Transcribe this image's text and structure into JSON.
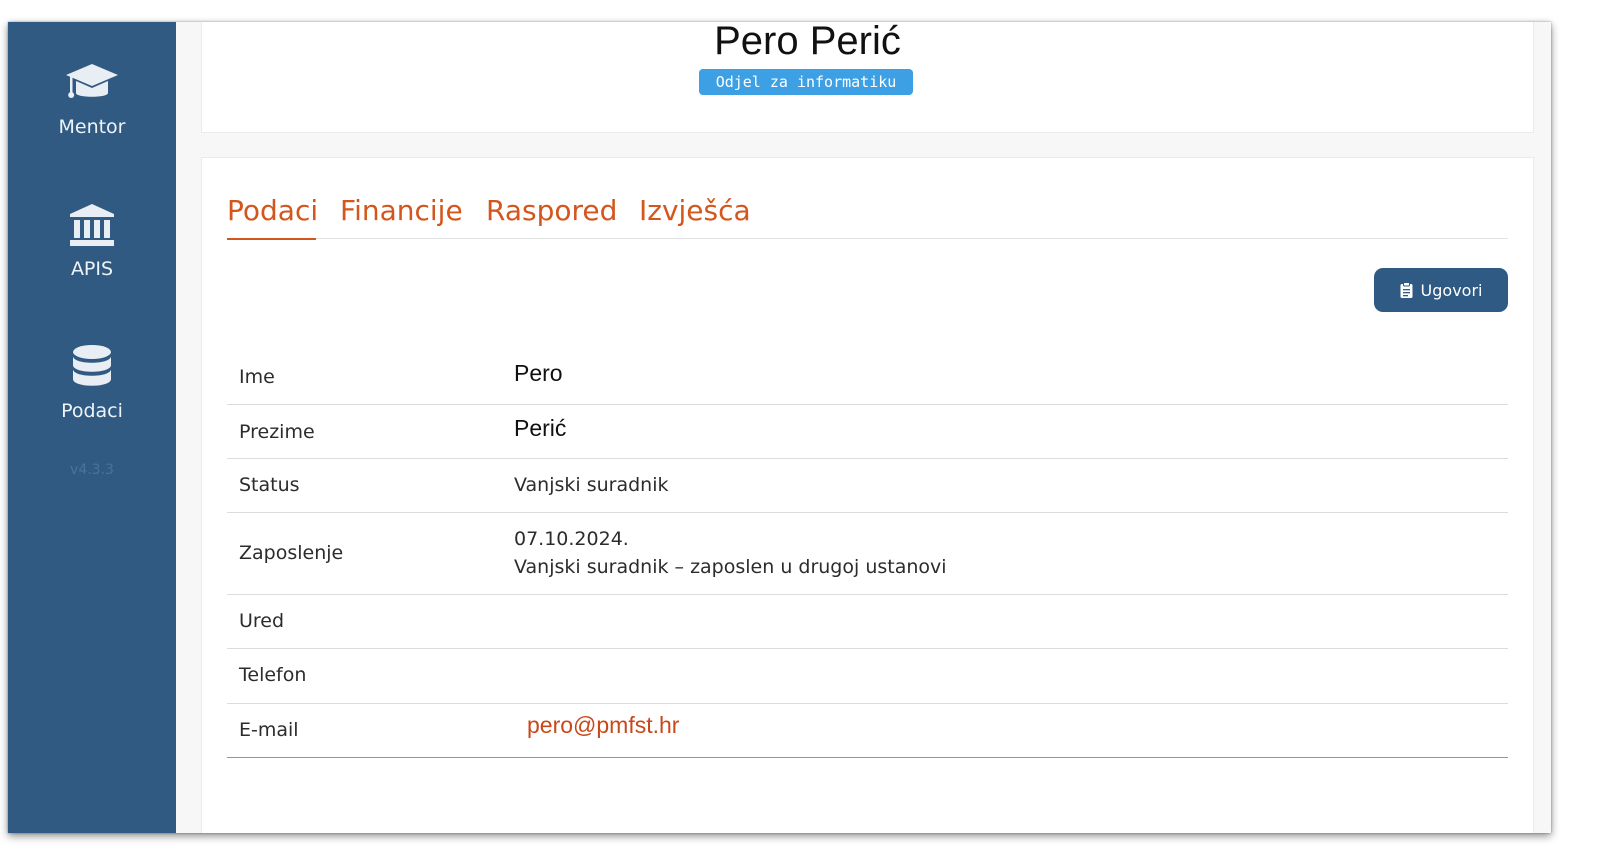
{
  "sidebar": {
    "items": [
      {
        "label": "Mentor",
        "icon": "graduation-cap-icon"
      },
      {
        "label": "APIS",
        "icon": "bank-icon"
      },
      {
        "label": "Podaci",
        "icon": "database-icon"
      }
    ],
    "version": "v4.3.3"
  },
  "header": {
    "name": "Pero Perić",
    "department": "Odjel za informatiku"
  },
  "tabs": [
    {
      "label": "Podaci",
      "active": true
    },
    {
      "label": "Financije",
      "active": false
    },
    {
      "label": "Raspored",
      "active": false
    },
    {
      "label": "Izvješća",
      "active": false
    }
  ],
  "actions": {
    "ugovori_label": "Ugovori"
  },
  "details": {
    "ime": {
      "label": "Ime",
      "value": "Pero"
    },
    "prezime": {
      "label": "Prezime",
      "value": "Perić"
    },
    "status": {
      "label": "Status",
      "value": "Vanjski suradnik"
    },
    "zaposlenje": {
      "label": "Zaposlenje",
      "date": "07.10.2024.",
      "description": "Vanjski suradnik – zaposlen u drugoj ustanovi"
    },
    "ured": {
      "label": "Ured",
      "value": ""
    },
    "telefon": {
      "label": "Telefon",
      "value": ""
    },
    "email": {
      "label": "E-mail",
      "value": "pero@pmfst.hr"
    }
  },
  "colors": {
    "sidebar": "#305a82",
    "accent": "#d4561c",
    "badge": "#3ea0e4",
    "button": "#2e5a84"
  }
}
